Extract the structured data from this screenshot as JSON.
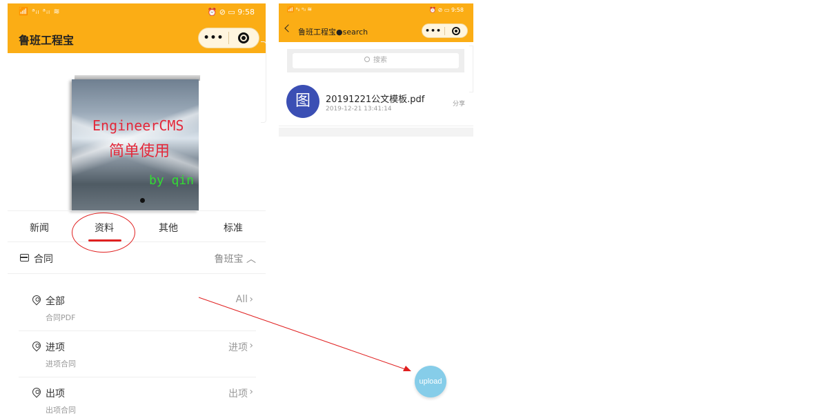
{
  "phone1": {
    "status": {
      "left": "📶 ᵃᵢₗ ᵃᵢₗ ≋",
      "right": "⏰ ⊘ ▭ 9:58"
    },
    "title": "鲁班工程宝",
    "capsule": {
      "more": "•••"
    },
    "banner": {
      "line1": "EngineerCMS",
      "line2": "简单使用",
      "line3": "by qin"
    },
    "tabs": [
      "新闻",
      "资料",
      "其他",
      "标准"
    ],
    "active_tab": 1,
    "section": {
      "label": "合同",
      "right": "鲁班宝 ︿"
    },
    "rows": [
      {
        "title": "全部",
        "subtitle": "合同PDF",
        "right": "All"
      },
      {
        "title": "进项",
        "subtitle": "进项合同",
        "right": "进项"
      },
      {
        "title": "出项",
        "subtitle": "出项合同",
        "right": "出项"
      }
    ]
  },
  "phone2": {
    "status": {
      "left": "📶 ᵃᵢₗ ᵃᵢₗ ≋",
      "right": "⏰ ⊘ ▭ 9:58"
    },
    "title": "鲁班工程宝●search",
    "capsule": {
      "more": "•••"
    },
    "search_placeholder": "搜索",
    "file": {
      "icon_text": "图",
      "name": "20191221公文模板.pdf",
      "time": "2019-12-21 13:41:14",
      "share": "分享"
    }
  },
  "annotation": {
    "upload_label": "upload",
    "color": "#e02020"
  },
  "colors": {
    "header": "#fbad15",
    "accent": "#e02020",
    "file_icon": "#3b4fb4",
    "upload": "#86cde9"
  }
}
